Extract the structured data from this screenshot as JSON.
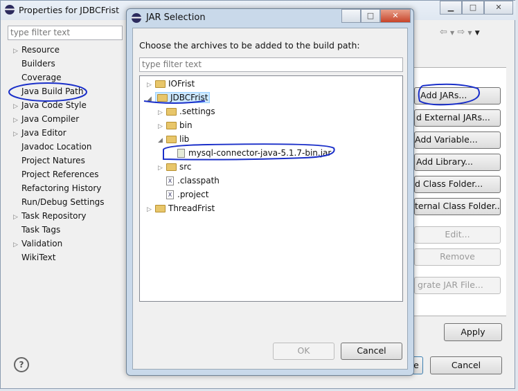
{
  "outer": {
    "title": "Properties for JDBCFrist",
    "filter_placeholder": "type filter text",
    "nav_items": [
      {
        "label": "Resource",
        "expandable": true
      },
      {
        "label": "Builders",
        "expandable": false
      },
      {
        "label": "Coverage",
        "expandable": false
      },
      {
        "label": "Java Build Path",
        "expandable": false
      },
      {
        "label": "Java Code Style",
        "expandable": true
      },
      {
        "label": "Java Compiler",
        "expandable": true
      },
      {
        "label": "Java Editor",
        "expandable": true
      },
      {
        "label": "Javadoc Location",
        "expandable": false
      },
      {
        "label": "Project Natures",
        "expandable": false
      },
      {
        "label": "Project References",
        "expandable": false
      },
      {
        "label": "Refactoring History",
        "expandable": false
      },
      {
        "label": "Run/Debug Settings",
        "expandable": false
      },
      {
        "label": "Task Repository",
        "expandable": true
      },
      {
        "label": "Task Tags",
        "expandable": false
      },
      {
        "label": "Validation",
        "expandable": true
      },
      {
        "label": "WikiText",
        "expandable": false
      }
    ],
    "side_buttons": [
      {
        "label": "Add JARs...",
        "enabled": true
      },
      {
        "label": "d External JARs...",
        "enabled": true
      },
      {
        "label": "Add Variable...",
        "enabled": true
      },
      {
        "label": "Add Library...",
        "enabled": true
      },
      {
        "label": "d Class Folder...",
        "enabled": true
      },
      {
        "label": "ternal Class Folder...",
        "enabled": true
      },
      {
        "label": "Edit...",
        "enabled": false
      },
      {
        "label": "Remove",
        "enabled": false
      },
      {
        "label": "grate JAR File...",
        "enabled": false
      }
    ],
    "apply": "Apply",
    "ok_partial": "e",
    "cancel": "Cancel",
    "help": "?"
  },
  "dialog": {
    "title": "JAR Selection",
    "instruction": "Choose the archives to be added to the build path:",
    "filter_placeholder": "type filter text",
    "tree": [
      {
        "label": "IOFrist",
        "kind": "project",
        "depth": 0,
        "toggle": "collapsed"
      },
      {
        "label": "JDBCFrist",
        "kind": "project",
        "depth": 0,
        "toggle": "expanded",
        "selected": true
      },
      {
        "label": ".settings",
        "kind": "folder",
        "depth": 1,
        "toggle": "collapsed"
      },
      {
        "label": "bin",
        "kind": "folder",
        "depth": 1,
        "toggle": "collapsed"
      },
      {
        "label": "lib",
        "kind": "folder",
        "depth": 1,
        "toggle": "expanded"
      },
      {
        "label": "mysql-connector-java-5.1.7-bin.jar",
        "kind": "jar",
        "depth": 2,
        "toggle": "none"
      },
      {
        "label": "src",
        "kind": "folder",
        "depth": 1,
        "toggle": "collapsed"
      },
      {
        "label": ".classpath",
        "kind": "file",
        "depth": 1,
        "toggle": "none"
      },
      {
        "label": ".project",
        "kind": "file",
        "depth": 1,
        "toggle": "none"
      },
      {
        "label": "ThreadFrist",
        "kind": "project",
        "depth": 0,
        "toggle": "collapsed"
      }
    ],
    "ok": "OK",
    "cancel": "Cancel"
  },
  "colors": {
    "annotation": "#1a2fc9",
    "selection": "#cce8ff"
  }
}
